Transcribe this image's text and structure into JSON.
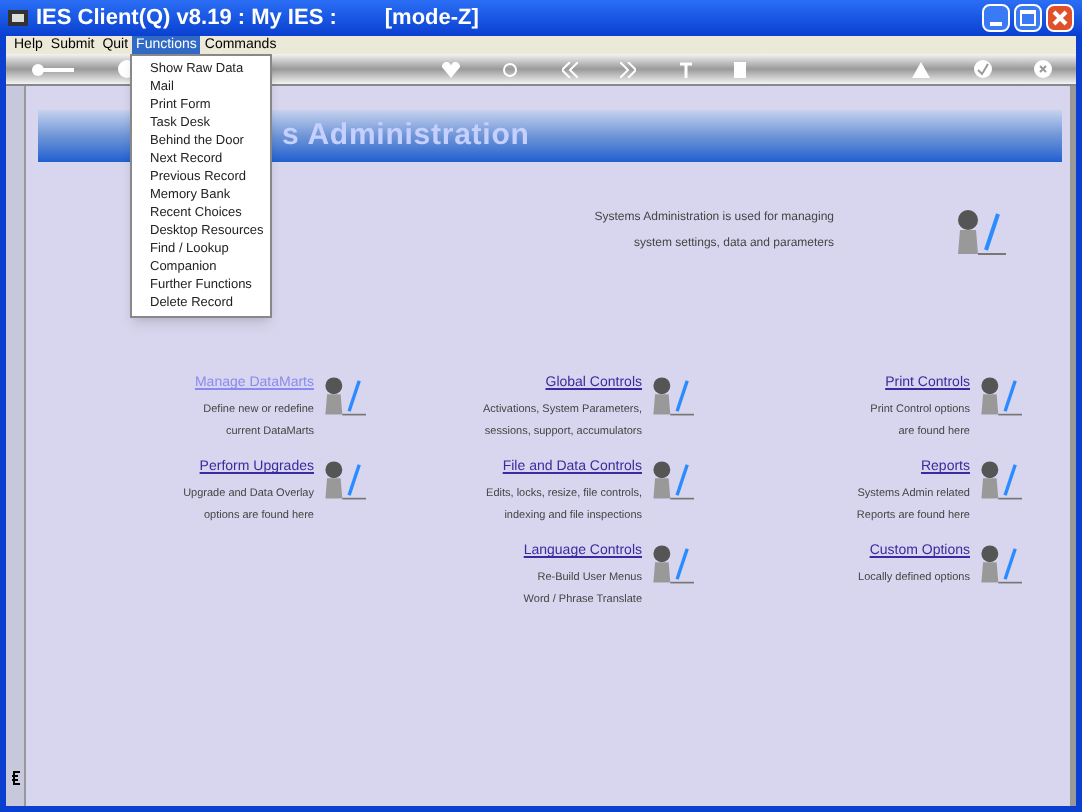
{
  "window": {
    "title": "IES Client(Q) v8.19 : My IES :",
    "mode": "[mode-Z]"
  },
  "menu_bar": [
    {
      "label": "Help",
      "selected": false
    },
    {
      "label": "Submit",
      "selected": false
    },
    {
      "label": "Quit",
      "selected": false
    },
    {
      "label": "Functions",
      "selected": true
    },
    {
      "label": "Commands",
      "selected": false
    }
  ],
  "functions_menu": [
    "Show Raw Data",
    "Mail",
    "Print Form",
    "Task Desk",
    "Behind the Door",
    "Next Record",
    "Previous Record",
    "Memory Bank",
    "Recent Choices",
    "Desktop Resources",
    "Find / Lookup",
    "Companion",
    "Further Functions",
    "Delete Record"
  ],
  "banner": {
    "title": "s Administration"
  },
  "intro": [
    "Systems Administration is used for managing",
    "system settings, data and parameters"
  ],
  "columns": [
    [
      {
        "link": "Manage DataMarts",
        "visited": true,
        "lines": [
          "Define new or redefine",
          "current DataMarts"
        ]
      },
      {
        "link": "Perform Upgrades",
        "visited": false,
        "lines": [
          "Upgrade and Data Overlay",
          "options are found here"
        ]
      }
    ],
    [
      {
        "link": "Global Controls",
        "visited": false,
        "lines": [
          "Activations, System Parameters,",
          "sessions, support, accumulators"
        ]
      },
      {
        "link": "File and Data Controls",
        "visited": false,
        "lines": [
          "Edits, locks, resize, file controls,",
          "indexing and file inspections"
        ]
      },
      {
        "link": "Language Controls",
        "visited": false,
        "lines": [
          "Re-Build User Menus",
          "Word / Phrase Translate"
        ]
      }
    ],
    [
      {
        "link": "Print Controls",
        "visited": false,
        "lines": [
          "Print Control options",
          "are found here"
        ]
      },
      {
        "link": "Reports",
        "visited": false,
        "lines": [
          "Systems Admin related",
          "Reports are found here"
        ]
      },
      {
        "link": "Custom Options",
        "visited": false,
        "lines": [
          "Locally defined options"
        ]
      }
    ]
  ]
}
